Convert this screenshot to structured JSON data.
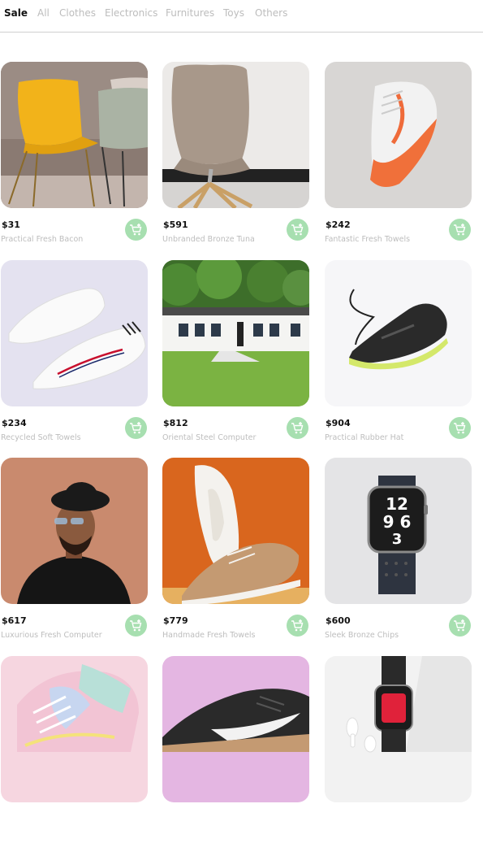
{
  "tabs": [
    {
      "label": "Sale",
      "active": true
    },
    {
      "label": "All"
    },
    {
      "label": "Clothes"
    },
    {
      "label": "Electronics"
    },
    {
      "label": "Furnitures"
    },
    {
      "label": "Toys"
    },
    {
      "label": "Others"
    }
  ],
  "products": [
    {
      "price": "$31",
      "name": "Practical Fresh Bacon",
      "image": "yellow-chairs"
    },
    {
      "price": "$591",
      "name": "Unbranded Bronze Tuna",
      "image": "beige-chair"
    },
    {
      "price": "$242",
      "name": "Fantastic Fresh Towels",
      "image": "orange-sneaker"
    },
    {
      "price": "$234",
      "name": "Recycled Soft Towels",
      "image": "white-sneakers"
    },
    {
      "price": "$812",
      "name": "Oriental Steel Computer",
      "image": "white-house"
    },
    {
      "price": "$904",
      "name": "Practical Rubber Hat",
      "image": "black-sneaker"
    },
    {
      "price": "$617",
      "name": "Luxurious Fresh Computer",
      "image": "man-in-hat"
    },
    {
      "price": "$779",
      "name": "Handmade Fresh Towels",
      "image": "tan-sneakers"
    },
    {
      "price": "$600",
      "name": "Sleek Bronze Chips",
      "image": "smartwatch"
    },
    {
      "price": "",
      "name": "",
      "image": "pastel-sneaker"
    },
    {
      "price": "",
      "name": "",
      "image": "nike-sneaker"
    },
    {
      "price": "",
      "name": "",
      "image": "watch-airpods"
    }
  ],
  "watch_face": {
    "line1": "12",
    "line2": "9 6",
    "line3": "3"
  },
  "colors": {
    "cart_button": "#a7dfb0",
    "muted_text": "#bdbdbd",
    "active_tab": "#111111"
  },
  "icons": {
    "cart": "add-to-cart-icon"
  }
}
